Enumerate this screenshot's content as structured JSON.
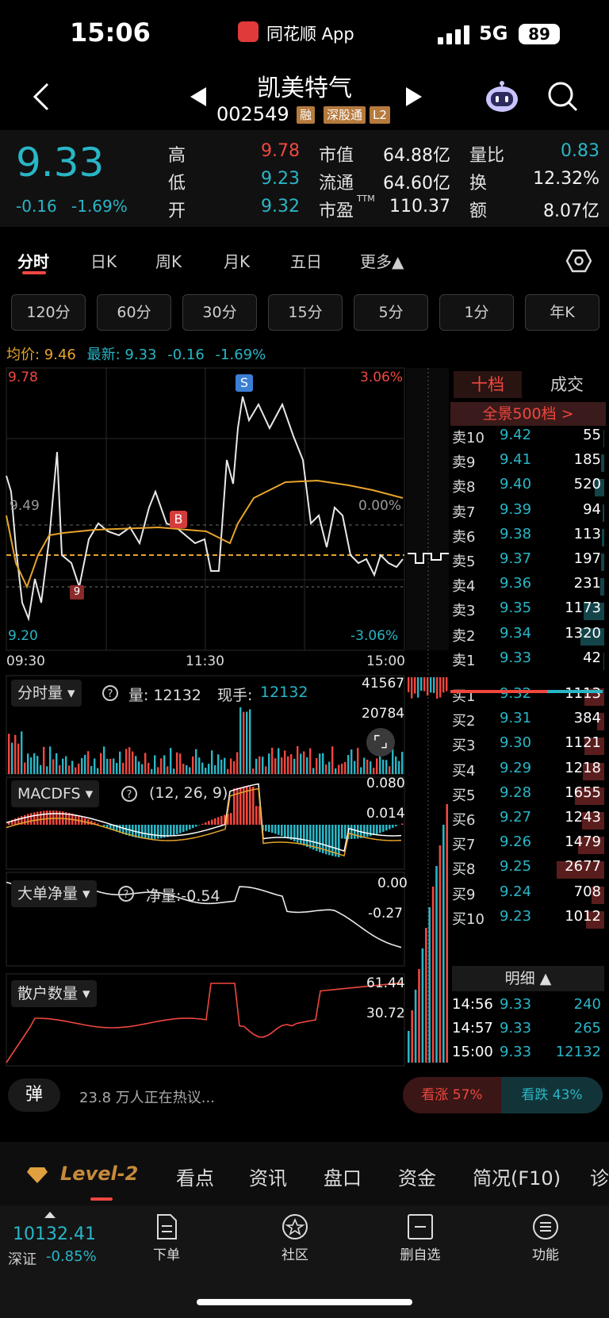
{
  "status": {
    "time": "15:06",
    "app": "同花顺 App",
    "network": "5G",
    "battery": "89"
  },
  "stock": {
    "name": "凯美特气",
    "code": "002549",
    "tags": [
      "融",
      "深股通",
      "L2"
    ]
  },
  "quote": {
    "price": "9.33",
    "change": "-0.16",
    "change_pct": "-1.69%",
    "high_label": "高",
    "high": "9.78",
    "low_label": "低",
    "low": "9.23",
    "open_label": "开",
    "open": "9.32",
    "mktcap_label": "市值",
    "mktcap": "64.88亿",
    "float_label": "流通",
    "float": "64.60亿",
    "pe_label": "市盈",
    "pe_sup": "TTM",
    "pe": "110.37",
    "volratio_label": "量比",
    "volratio": "0.83",
    "turnover_label": "换",
    "turnover": "12.32%",
    "amount_label": "额",
    "amount": "8.07亿"
  },
  "period_tabs": [
    "分时",
    "日K",
    "周K",
    "月K",
    "五日",
    "更多▲"
  ],
  "minute_buttons": [
    "120分",
    "60分",
    "30分",
    "15分",
    "5分",
    "1分",
    "年K"
  ],
  "info_line": {
    "avg_label": "均价: 9.46",
    "latest_label": "最新: 9.33",
    "change": "-0.16",
    "pct": "-1.69%"
  },
  "chart_labels": {
    "top_price": "9.78",
    "top_pct": "3.06%",
    "mid_price": "9.49",
    "mid_pct": "0.00%",
    "bottom_price": "9.20",
    "bottom_pct": "-3.06%",
    "time_start": "09:30",
    "time_mid": "11:30",
    "time_end": "15:00",
    "marker_s": "S",
    "marker_b": "B",
    "marker_9": "9"
  },
  "volume_panel": {
    "name": "分时量",
    "vol_label": "量: 12132",
    "now_label": "现手: ",
    "now_value": "12132",
    "max1": "41567",
    "max2": "20784"
  },
  "macd_panel": {
    "name": "MACDFS",
    "params": "(12, 26, 9)",
    "v1": "0.080",
    "v2": "0.014"
  },
  "bigorder_panel": {
    "name": "大单净量",
    "label": "净量:-0.54",
    "v1": "0.00",
    "v2": "-0.27"
  },
  "retail_panel": {
    "name": "散户数量",
    "v1": "61.44",
    "v2": "30.72"
  },
  "orderbook": {
    "tab_active": "十档",
    "tab_other": "成交",
    "full_label": "全景500档 >",
    "asks": [
      {
        "label": "卖10",
        "price": "9.42",
        "vol": "55"
      },
      {
        "label": "卖9",
        "price": "9.41",
        "vol": "185"
      },
      {
        "label": "卖8",
        "price": "9.40",
        "vol": "520"
      },
      {
        "label": "卖7",
        "price": "9.39",
        "vol": "94"
      },
      {
        "label": "卖6",
        "price": "9.38",
        "vol": "113"
      },
      {
        "label": "卖5",
        "price": "9.37",
        "vol": "197"
      },
      {
        "label": "卖4",
        "price": "9.36",
        "vol": "231"
      },
      {
        "label": "卖3",
        "price": "9.35",
        "vol": "1173"
      },
      {
        "label": "卖2",
        "price": "9.34",
        "vol": "1320"
      },
      {
        "label": "卖1",
        "price": "9.33",
        "vol": "42"
      }
    ],
    "bids": [
      {
        "label": "买1",
        "price": "9.32",
        "vol": "1113"
      },
      {
        "label": "买2",
        "price": "9.31",
        "vol": "384"
      },
      {
        "label": "买3",
        "price": "9.30",
        "vol": "1121"
      },
      {
        "label": "买4",
        "price": "9.29",
        "vol": "1218"
      },
      {
        "label": "买5",
        "price": "9.28",
        "vol": "1655"
      },
      {
        "label": "买6",
        "price": "9.27",
        "vol": "1243"
      },
      {
        "label": "买7",
        "price": "9.26",
        "vol": "1479"
      },
      {
        "label": "买8",
        "price": "9.25",
        "vol": "2677"
      },
      {
        "label": "买9",
        "price": "9.24",
        "vol": "708"
      },
      {
        "label": "买10",
        "price": "9.23",
        "vol": "1012"
      }
    ],
    "detail_label": "明细",
    "trades": [
      {
        "time": "14:56",
        "price": "9.33",
        "vol": "240"
      },
      {
        "time": "14:57",
        "price": "9.33",
        "vol": "265"
      },
      {
        "time": "15:00",
        "price": "9.33",
        "vol": "12132"
      }
    ]
  },
  "hot": {
    "danmu": "弹",
    "text": "23.8 万人正在热议...",
    "up": "看涨 57%",
    "down": "看跌 43%"
  },
  "bottom_tabs": [
    "Level-2",
    "看点",
    "资讯",
    "盘口",
    "资金",
    "简况(F10)",
    "诊"
  ],
  "toolbar": {
    "index_value": "10132.41",
    "index_name": "深证",
    "index_pct": "-0.85%",
    "items": [
      "下单",
      "社区",
      "删自选",
      "功能"
    ]
  }
}
